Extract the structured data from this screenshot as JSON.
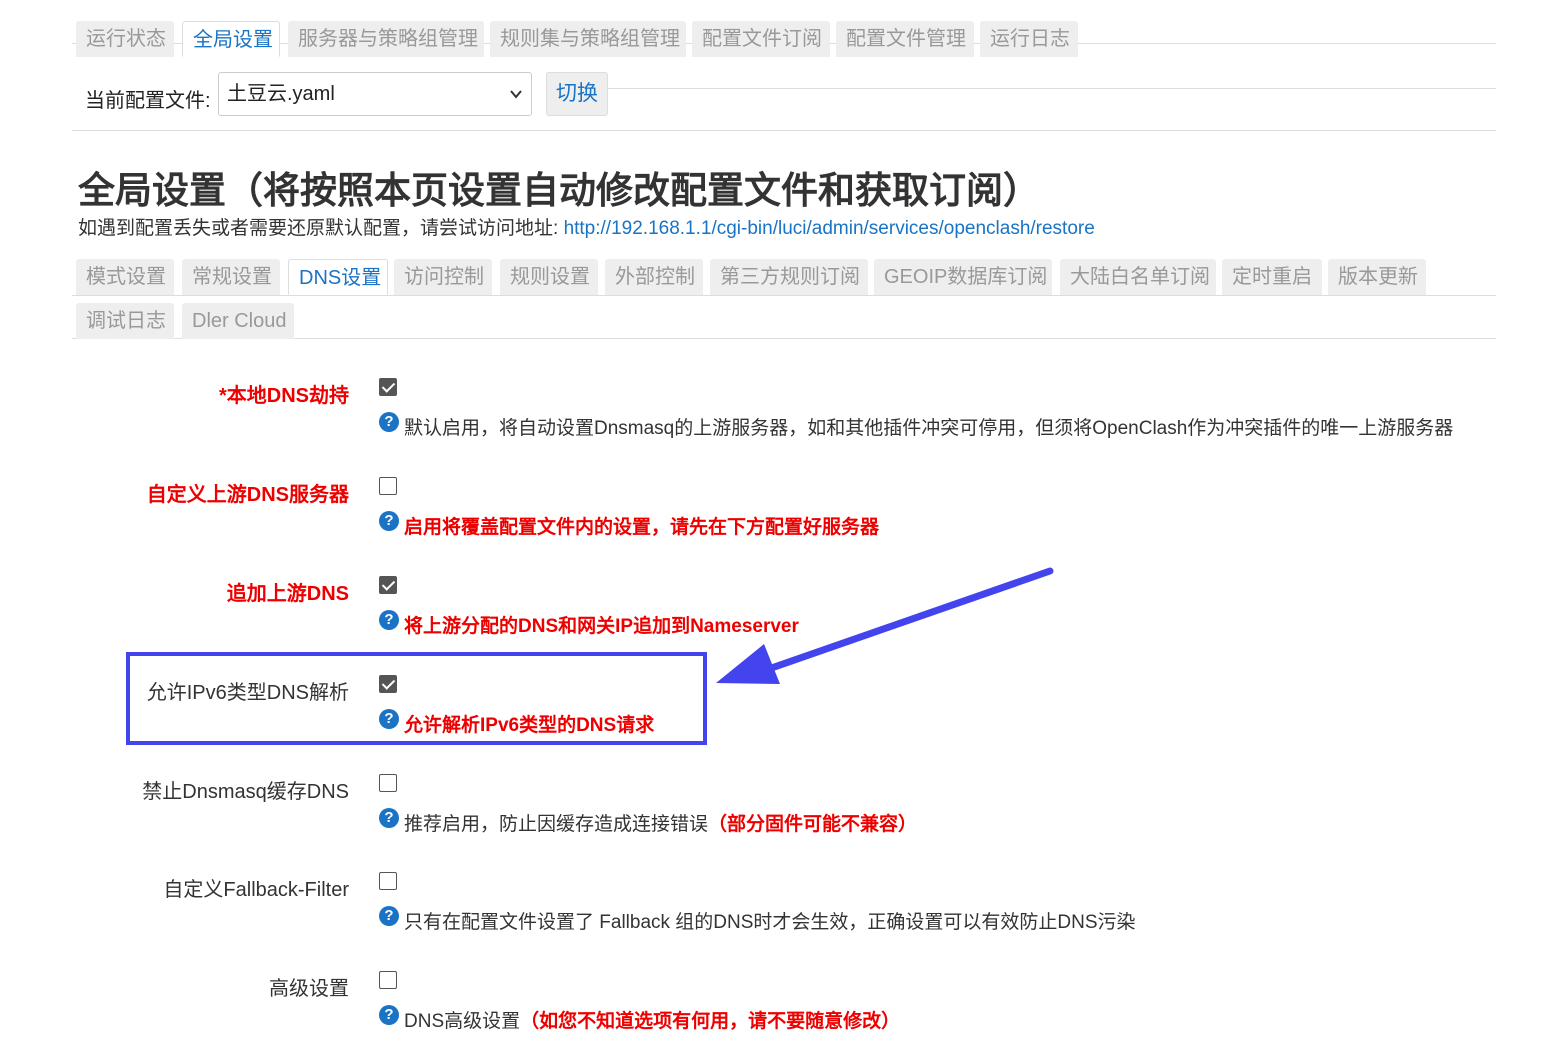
{
  "top_tabs": [
    {
      "label": "运行状态"
    },
    {
      "label": "全局设置"
    },
    {
      "label": "服务器与策略组管理"
    },
    {
      "label": "规则集与策略组管理"
    },
    {
      "label": "配置文件订阅"
    },
    {
      "label": "配置文件管理"
    },
    {
      "label": "运行日志"
    }
  ],
  "config": {
    "label": "当前配置文件:",
    "selected": "土豆云.yaml",
    "switch_label": "切换"
  },
  "page": {
    "title": "全局设置（将按照本页设置自动修改配置文件和获取订阅）",
    "restore_text": "如遇到配置丢失或者需要还原默认配置，请尝试访问地址: ",
    "restore_link": "http://192.168.1.1/cgi-bin/luci/admin/services/openclash/restore"
  },
  "sub_tabs": [
    {
      "label": "模式设置"
    },
    {
      "label": "常规设置"
    },
    {
      "label": "DNS设置"
    },
    {
      "label": "访问控制"
    },
    {
      "label": "规则设置"
    },
    {
      "label": "外部控制"
    },
    {
      "label": "第三方规则订阅"
    },
    {
      "label": "GEOIP数据库订阅"
    },
    {
      "label": "大陆白名单订阅"
    },
    {
      "label": "定时重启"
    },
    {
      "label": "版本更新"
    },
    {
      "label": "调试日志"
    },
    {
      "label": "Dler Cloud"
    }
  ],
  "settings": [
    {
      "label": "*本地DNS劫持",
      "checked": true,
      "desc": "默认启用，将自动设置Dnsmasq的上游服务器，如和其他插件冲突可停用，但须将OpenClash作为冲突插件的唯一上游服务器"
    },
    {
      "label": "自定义上游DNS服务器",
      "checked": false,
      "desc": "启用将覆盖配置文件内的设置，请先在下方配置好服务器"
    },
    {
      "label": "追加上游DNS",
      "checked": true,
      "desc": "将上游分配的DNS和网关IP追加到Nameserver"
    },
    {
      "label": "允许IPv6类型DNS解析",
      "checked": true,
      "desc": "允许解析IPv6类型的DNS请求"
    },
    {
      "label": "禁止Dnsmasq缓存DNS",
      "checked": false,
      "desc": "推荐启用，防止因缓存造成连接错误",
      "desc_red": "（部分固件可能不兼容）"
    },
    {
      "label": "自定义Fallback-Filter",
      "checked": false,
      "desc": "只有在配置文件设置了 Fallback 组的DNS时才会生效，正确设置可以有效防止DNS污染"
    },
    {
      "label": "高级设置",
      "checked": false,
      "desc": "DNS高级设置",
      "desc_red": "（如您不知道选项有何用，请不要随意修改）"
    }
  ],
  "help_glyph": "?",
  "icons": {
    "help": "question-circle-icon",
    "chevron": "chevron-down-icon",
    "annotation": "arrow-annotation"
  },
  "colors": {
    "accent": "#1a73c4",
    "warning": "#ee0000",
    "highlight": "#4444ee"
  }
}
